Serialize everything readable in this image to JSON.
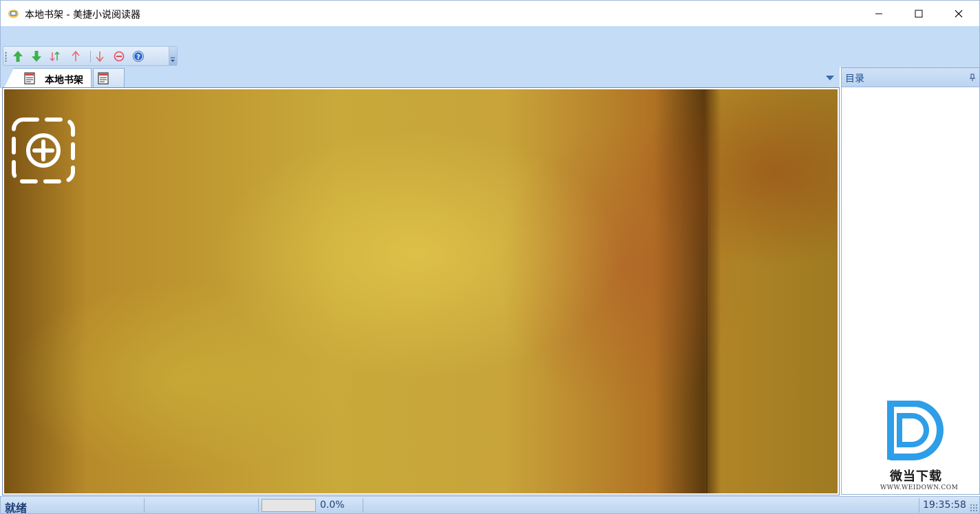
{
  "window": {
    "title": "本地书架 - 美捷小说阅读器",
    "icon": "book-app-icon",
    "controls": [
      "minimize-icon",
      "maximize-icon",
      "close-icon"
    ]
  },
  "toolbar": {
    "buttons": [
      {
        "name": "move-up-icon",
        "color": "#3cb24a"
      },
      {
        "name": "move-down-icon",
        "color": "#3cb24a"
      },
      {
        "name": "sort-icon",
        "color": "#e8668a"
      },
      {
        "name": "move-top-icon",
        "color": "#e86a6a"
      },
      {
        "name": "move-bottom-icon",
        "color": "#e86a6a"
      },
      {
        "name": "remove-icon",
        "color": "#e84a5a"
      },
      {
        "name": "help-icon",
        "color": "#2e6dd0"
      }
    ]
  },
  "tabs": {
    "active_label": "本地书架",
    "items": [
      {
        "label": "本地书架",
        "active": true
      },
      {
        "label": "",
        "active": false
      }
    ]
  },
  "panel": {
    "title": "目录",
    "watermark_text": "微当下载",
    "watermark_url": "WWW.WEIDOWN.COM",
    "watermark_color": "#2e9ee8"
  },
  "status": {
    "text": "就绪",
    "progress_percent": 0,
    "progress_label": "0.0%",
    "time": "19:35:58"
  }
}
